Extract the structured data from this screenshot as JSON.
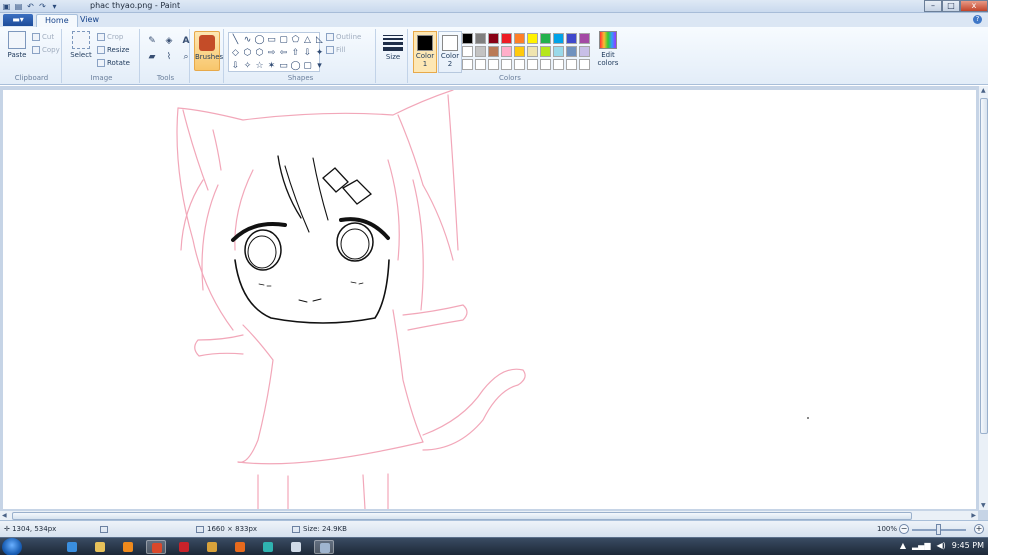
{
  "window": {
    "title": "phac thyao.png - Paint",
    "controls": {
      "minimize": "–",
      "maximize": "□",
      "close": "x"
    }
  },
  "quick_access": [
    "save-icon",
    "undo-icon",
    "redo-icon",
    "customize-icon"
  ],
  "tabs": {
    "app_menu": "▬▾",
    "items": [
      {
        "label": "Home",
        "active": true
      },
      {
        "label": "View",
        "active": false
      }
    ],
    "help": "?"
  },
  "ribbon": {
    "clipboard": {
      "label": "Clipboard",
      "paste": "Paste",
      "cut": "Cut",
      "copy": "Copy"
    },
    "image": {
      "label": "Image",
      "select": "Select",
      "crop": "Crop",
      "resize": "Resize",
      "rotate": "Rotate"
    },
    "tools": {
      "label": "Tools",
      "icons": [
        "pencil-icon",
        "fill-icon",
        "text-icon",
        "eraser-icon",
        "color-picker-icon",
        "magnifier-icon"
      ]
    },
    "brushes": {
      "label": "Brushes"
    },
    "shapes": {
      "label": "Shapes",
      "glyphs": [
        "╲",
        "∿",
        "◯",
        "▭",
        "▢",
        "⬠",
        "△",
        "◺",
        "◇",
        "⬡",
        "⬡",
        "⇨",
        "⇦",
        "⇧",
        "⇩",
        "✦",
        "⇩",
        "✧",
        "☆",
        "✶",
        "▭",
        "◯",
        "▢",
        "▾"
      ],
      "outline": "Outline",
      "fill": "Fill"
    },
    "size": {
      "label": "Size"
    },
    "color1": {
      "label": "Color",
      "num": "1",
      "color": "#000000"
    },
    "color2": {
      "label": "Color",
      "num": "2",
      "color": "#ffffff"
    },
    "colors": {
      "label": "Colors",
      "palette": [
        "#000000",
        "#7f7f7f",
        "#880015",
        "#ed1c24",
        "#ff7f27",
        "#fff200",
        "#22b14c",
        "#00a2e8",
        "#3f48cc",
        "#a349a4",
        "#ffffff",
        "#c3c3c3",
        "#b97a57",
        "#ffaec9",
        "#ffc90e",
        "#efe4b0",
        "#b5e61d",
        "#99d9ea",
        "#7092be",
        "#c8bfe7",
        "#ffffff",
        "#ffffff",
        "#ffffff",
        "#ffffff",
        "#ffffff",
        "#ffffff",
        "#ffffff",
        "#ffffff",
        "#ffffff",
        "#ffffff"
      ],
      "edit": "Edit colors"
    }
  },
  "status": {
    "cursor": "1304, 534px",
    "selection": "",
    "dimensions": "1660 × 833px",
    "size": "Size: 24.9KB",
    "zoom": "100%",
    "zoom_out": "−",
    "zoom_in": "+"
  },
  "taskbar": {
    "apps": [
      {
        "name": "ie-icon",
        "color": "#3a8fe0",
        "active": false
      },
      {
        "name": "explorer-icon",
        "color": "#e8c25a",
        "active": false
      },
      {
        "name": "media-player-icon",
        "color": "#f08a1c",
        "active": false
      },
      {
        "name": "chrome-icon",
        "color": "#d9482b",
        "active": true
      },
      {
        "name": "app-red-icon",
        "color": "#c8222a",
        "active": false
      },
      {
        "name": "app-box-icon",
        "color": "#d9a23a",
        "active": false
      },
      {
        "name": "firefox-icon",
        "color": "#e86a1d",
        "active": false
      },
      {
        "name": "app-teal-icon",
        "color": "#2fb3b0",
        "active": false
      },
      {
        "name": "notepad-icon",
        "color": "#d0dbe8",
        "active": false
      },
      {
        "name": "paint-icon",
        "color": "#9fb5cf",
        "active": true
      }
    ],
    "tray": {
      "arrow": "▲",
      "network": "▂▄▆",
      "volume": "◀)",
      "time": "9:45 PM"
    }
  }
}
